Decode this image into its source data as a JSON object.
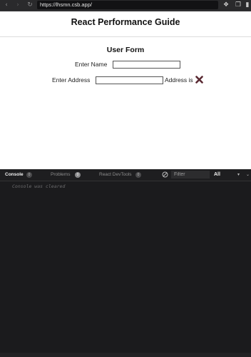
{
  "browser": {
    "url": "https://lhsmn.csb.app/",
    "icons": [
      "back-arrow-icon",
      "forward-arrow-icon",
      "reload-icon",
      "extension-icon",
      "copy-icon",
      "panel-icon"
    ]
  },
  "app": {
    "title": "React Performance Guide",
    "form_title": "User Form",
    "name_label": "Enter Name",
    "name_value": "",
    "address_label": "Enter Address",
    "address_value": "",
    "address_status_label": "Address is",
    "address_status_icon": "x-mark-icon"
  },
  "devtools": {
    "tabs": [
      {
        "label": "Console",
        "badge": "0",
        "active": true
      },
      {
        "label": "Problems",
        "badge": "0",
        "active": false
      },
      {
        "label": "React DevTools",
        "badge": "0",
        "active": false
      }
    ],
    "filter_placeholder": "Filter",
    "level": "All",
    "console_message": "Console was cleared"
  },
  "colors": {
    "x_mark": "#5a2a33",
    "devtools_bg": "#1b1b1d",
    "preview_bg": "#ffffff"
  }
}
